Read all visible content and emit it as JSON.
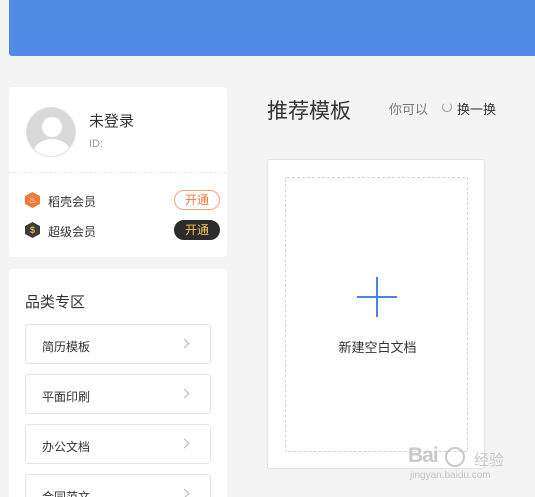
{
  "user": {
    "name": "未登录",
    "id_label": "ID:"
  },
  "memberships": [
    {
      "label": "稻壳会员",
      "button": "开通",
      "icon": "rice-member-icon",
      "icon_glyph": "♨"
    },
    {
      "label": "超级会员",
      "button": "开通",
      "icon": "super-member-icon",
      "icon_glyph": "$"
    }
  ],
  "category": {
    "title": "品类专区",
    "items": [
      "简历模板",
      "平面印刷",
      "办公文档",
      "合同范文"
    ]
  },
  "main": {
    "title": "推荐模板",
    "hint": "你可以",
    "refresh_label": "换一换",
    "blank_doc_label": "新建空白文档"
  },
  "watermark": {
    "brand": "Bai",
    "brand_cn": "经验",
    "url": "jingyan.baidu.com"
  },
  "colors": {
    "top_bar": "#5089e6",
    "accent_orange": "#f07a3c",
    "plus_blue": "#4a84e4"
  }
}
